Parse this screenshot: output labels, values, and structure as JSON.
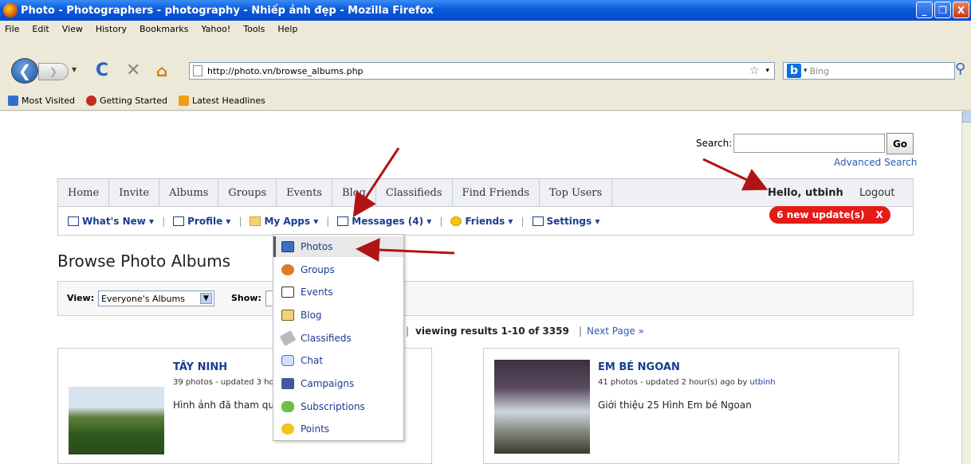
{
  "window": {
    "title": "Photo - Photographers - photography - Nhiếp ảnh đẹp - Mozilla Firefox",
    "minimize": "_",
    "maximize": "❐",
    "close": "X"
  },
  "menubar": [
    "File",
    "Edit",
    "View",
    "History",
    "Bookmarks",
    "Yahoo!",
    "Tools",
    "Help"
  ],
  "navbar": {
    "back": "❮",
    "forward": "❯",
    "reload_icon": "reload-icon",
    "stop_icon": "stop-icon",
    "home_icon": "home-icon",
    "url": "http://photo.vn/browse_albums.php",
    "search_placeholder": "Bing",
    "search_engine": "b"
  },
  "bookmarks": [
    "Most Visited",
    "Getting Started",
    "Latest Headlines"
  ],
  "site": {
    "search_label": "Search:",
    "search_value": "",
    "go_label": "Go",
    "advanced_search": "Advanced Search",
    "topnav": [
      "Home",
      "Invite",
      "Albums",
      "Groups",
      "Events",
      "Blog",
      "Classifieds",
      "Find Friends",
      "Top Users"
    ],
    "hello": "Hello, utbinh",
    "logout": "Logout",
    "updates_badge": "6 new update(s)",
    "updates_close": "X",
    "subnav": {
      "whats_new": "What's New ▾",
      "profile": "Profile ▾",
      "my_apps": "My Apps ▾",
      "messages": "Messages (4) ▾",
      "friends": "Friends ▾",
      "settings": "Settings ▾"
    },
    "page_title": "Browse Photo Albums",
    "view_label": "View:",
    "view_value": "Everyone's Albums",
    "show_label": "Show:",
    "results_text": "viewing results 1-10 of 3359",
    "next_page": "Next Page »",
    "albums": [
      {
        "title": "TÂY NINH",
        "meta": "39 photos - updated 3 hou",
        "desc": "Hình ảnh đã tham qua"
      },
      {
        "title": "EM BÉ NGOAN",
        "meta": "41 photos - updated 2 hour(s) ago by",
        "meta_user": "utbinh",
        "desc": "Giới thiệu 25 Hình Em bé Ngoan"
      }
    ],
    "my_apps_menu": [
      "Photos",
      "Groups",
      "Events",
      "Blog",
      "Classifieds",
      "Chat",
      "Campaigns",
      "Subscriptions",
      "Points"
    ]
  },
  "colors": {
    "annotation_arrow": "#b01414",
    "badge": "#e41b17",
    "link": "#1a3d8f"
  }
}
